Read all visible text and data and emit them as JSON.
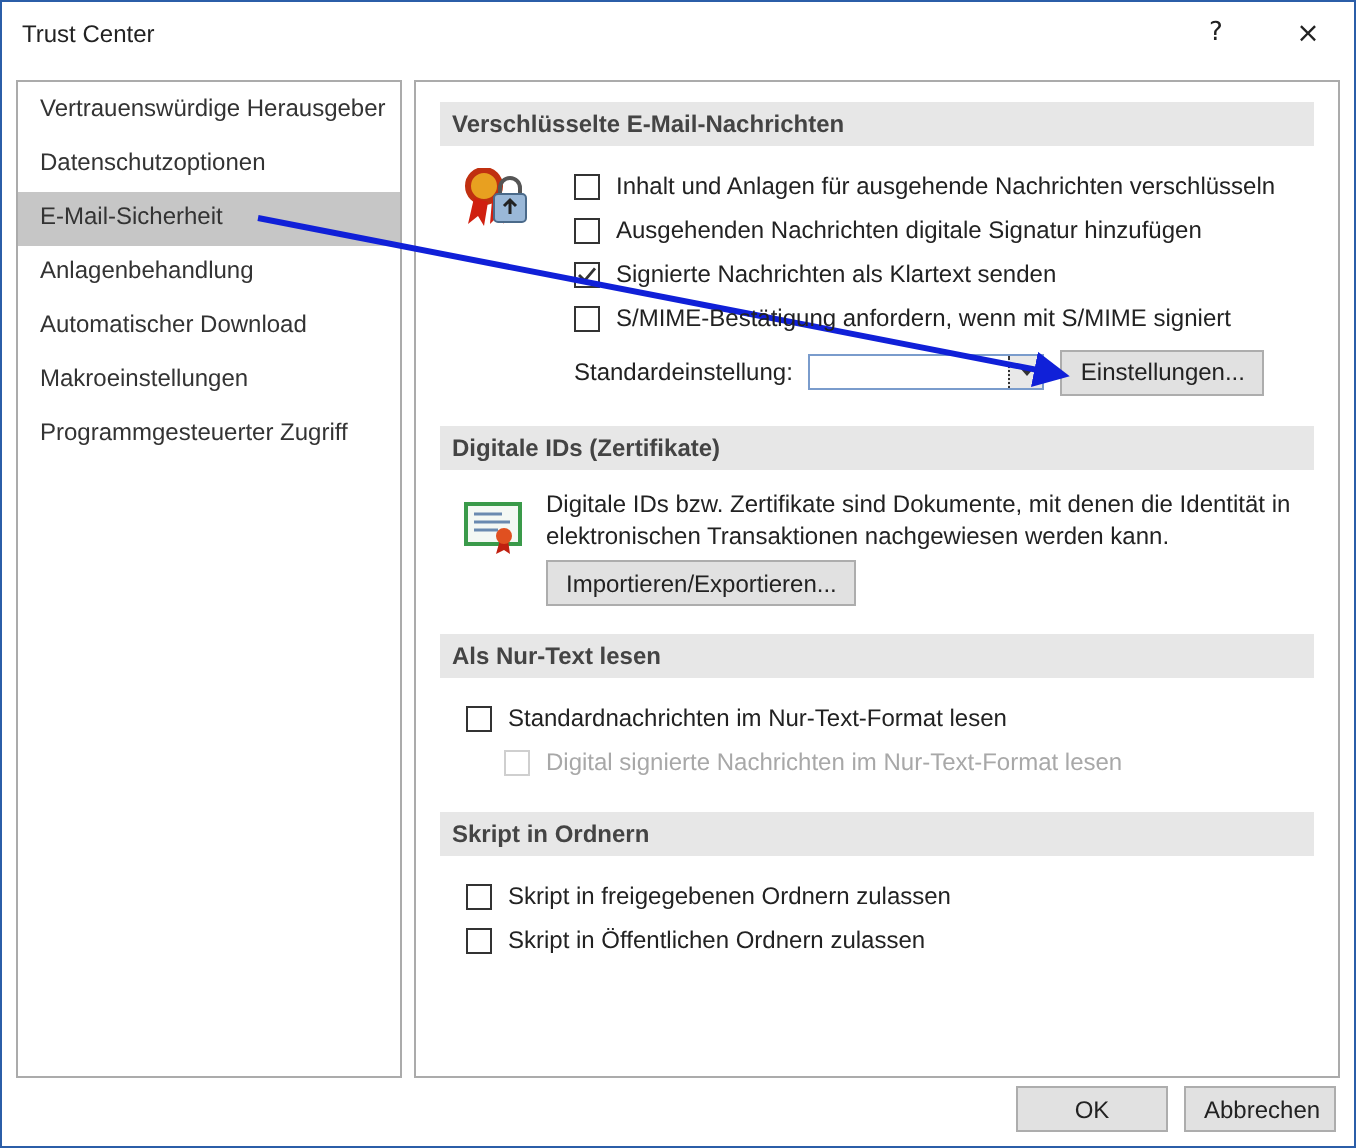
{
  "window": {
    "title": "Trust Center",
    "help": "?",
    "close": "×"
  },
  "sidebar": {
    "items": [
      {
        "label": "Vertrauenswürdige Herausgeber",
        "selected": false
      },
      {
        "label": "Datenschutzoptionen",
        "selected": false
      },
      {
        "label": "E-Mail-Sicherheit",
        "selected": true
      },
      {
        "label": "Anlagenbehandlung",
        "selected": false
      },
      {
        "label": "Automatischer Download",
        "selected": false
      },
      {
        "label": "Makroeinstellungen",
        "selected": false
      },
      {
        "label": "Programmgesteuerter Zugriff",
        "selected": false
      }
    ]
  },
  "sections": [
    {
      "title": "Verschlüsselte E-Mail-Nachrichten",
      "items": [
        {
          "kind": "checkbox",
          "label": "Inhalt und Anlagen für ausgehende Nachrichten verschlüsseln",
          "checked": false,
          "disabled": false
        },
        {
          "kind": "checkbox",
          "label": "Ausgehenden Nachrichten digitale Signatur hinzufügen",
          "checked": false,
          "disabled": false
        },
        {
          "kind": "checkbox",
          "label": "Signierte Nachrichten als Klartext senden",
          "checked": true,
          "disabled": false
        },
        {
          "kind": "checkbox",
          "label": "S/MIME-Bestätigung anfordern, wenn mit S/MIME signiert",
          "checked": false,
          "disabled": false
        },
        {
          "kind": "combo",
          "label": "Standardeinstellung:",
          "button": "Einstellungen..."
        }
      ]
    },
    {
      "title": "Digitale IDs (Zertifikate)",
      "items": [
        {
          "kind": "text",
          "text": "Digitale IDs bzw. Zertifikate sind Dokumente, mit denen die Identität in elektronischen Transaktionen nachgewiesen werden kann."
        },
        {
          "kind": "button",
          "label": "Importieren/Exportieren..."
        }
      ]
    },
    {
      "title": "Als Nur-Text lesen",
      "items": [
        {
          "kind": "checkbox",
          "label": "Standardnachrichten im Nur-Text-Format lesen",
          "checked": false,
          "disabled": false,
          "children": [
            {
              "kind": "checkbox",
              "label": "Digital signierte Nachrichten im Nur-Text-Format lesen",
              "checked": false,
              "disabled": true
            }
          ]
        }
      ]
    },
    {
      "title": "Skript in Ordnern",
      "items": [
        {
          "kind": "checkbox",
          "label": "Skript in freigegebenen Ordnern zulassen",
          "checked": false,
          "disabled": false
        },
        {
          "kind": "checkbox",
          "label": "Skript in Öffentlichen Ordnern zulassen",
          "checked": false,
          "disabled": false
        }
      ]
    }
  ],
  "buttons": [
    "OK",
    "Abbrechen"
  ]
}
